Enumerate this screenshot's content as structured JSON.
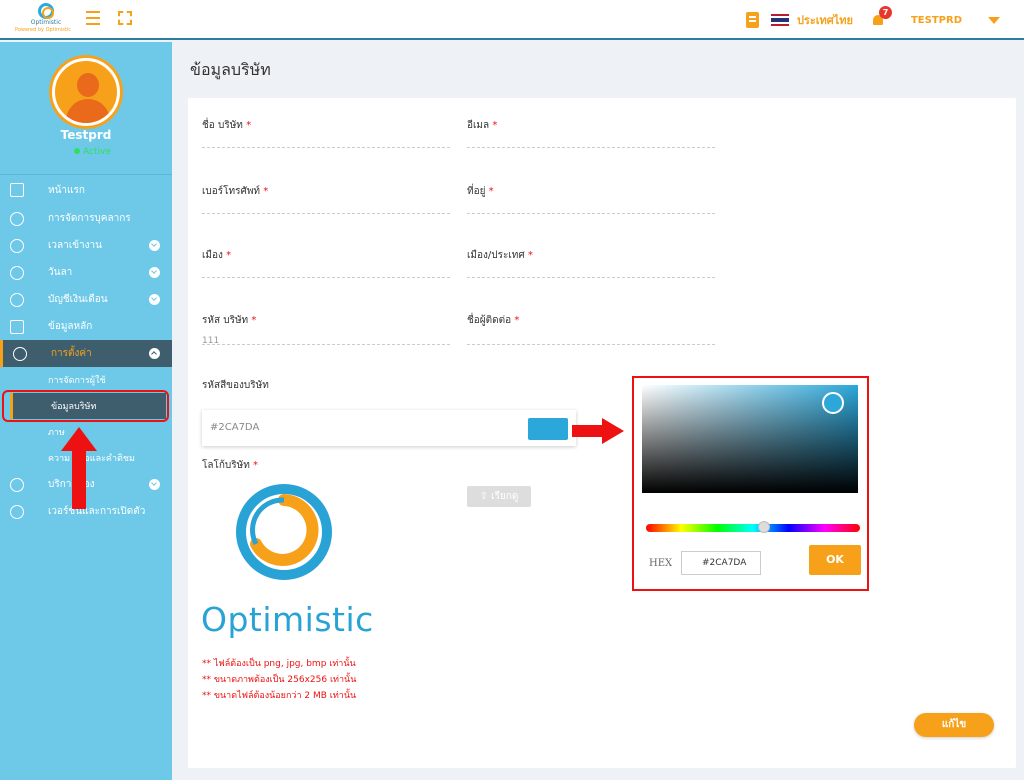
{
  "app": {
    "logo_name": "Optimistic",
    "logo_sub": "Powered by Optimistic",
    "language": "ประเทศไทย",
    "notification_count": "7",
    "username": "TESTPRD"
  },
  "profile": {
    "name": "Testprd",
    "status": "Active"
  },
  "menu": [
    {
      "label": "หน้าแรก",
      "icon": "home-icon"
    },
    {
      "label": "การจัดการบุคลากร",
      "icon": "people-icon"
    },
    {
      "label": "เวลาเข้างาน",
      "icon": "clock-icon"
    },
    {
      "label": "วันลา",
      "icon": "calendar-icon"
    },
    {
      "label": "บัญชีเงินเดือน",
      "icon": "dollar-icon"
    },
    {
      "label": "ข้อมูลหลัก",
      "icon": "briefcase-icon"
    },
    {
      "label": "การตั้งค่า",
      "icon": "gear-icon"
    },
    {
      "label": "บริการของ",
      "icon": "user-icon"
    },
    {
      "label": "เวอร์ชันและการเปิดตัว",
      "icon": "version-icon"
    }
  ],
  "submenu": [
    "การจัดการผู้ใช้",
    "ข้อมูลบริษัท",
    "ภาษ",
    "ความ หลือและคำติชม"
  ],
  "page": {
    "title": "ข้อมูลบริษัท"
  },
  "form": {
    "company_name": "ชื่อ บริษัท",
    "email": "อีเมล",
    "phone": "เบอร์โทรศัพท์",
    "address": "ที่อยู่",
    "city": "เมือง",
    "country": "เมือง/ประเทศ",
    "company_code": "รหัส บริษัท",
    "company_code_value": "111",
    "contact": "ชื่อผู้ติดต่อ",
    "required_mark": "*",
    "color_label": "รหัสสีของบริษัท",
    "color_value": "#2CA7DA",
    "logo_label": "โลโก้บริษัท",
    "upload_button": "เรียกดู",
    "brand_text": "Optimistic",
    "notes": [
      "** ไฟล์ต้องเป็น png, jpg, bmp เท่านั้น",
      "** ขนาดภาพต้องเป็น 256x256 เท่านั้น",
      "** ขนาดไฟล์ต้องน้อยกว่า 2 MB เท่านั้น"
    ],
    "save_button": "แก้ไข"
  },
  "picker": {
    "hex_label": "HEX",
    "hex_value": "#2CA7DA",
    "ok_button": "OK",
    "selected_color": "#2ca7da"
  },
  "colors": {
    "accent": "#f7a11a",
    "sidebar": "#6ec8e8",
    "active_bg": "#3e5e6e",
    "highlight": "#e11111"
  }
}
